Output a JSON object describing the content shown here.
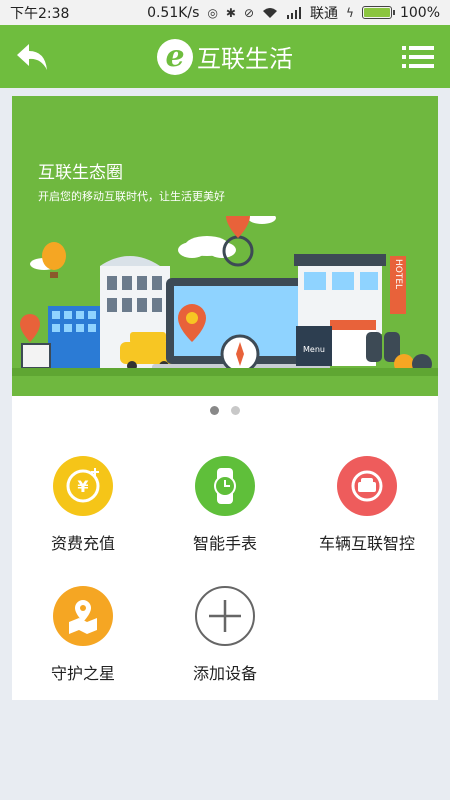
{
  "status_bar": {
    "time": "下午2:38",
    "speed": "0.51K/s",
    "carrier": "联通",
    "battery": "100%",
    "battery_level": 1.0
  },
  "header": {
    "title": "互联生活",
    "logo_letter": "e",
    "back_icon": "back-arrow-icon",
    "menu_icon": "list-menu-icon"
  },
  "banner": {
    "title": "互联生态圈",
    "subtitle": "开启您的移动互联时代，让生活更美好",
    "signs": {
      "hotel": "HOTEL",
      "menu": "Menu"
    },
    "page_count": 2,
    "active_page": 1
  },
  "features": [
    {
      "label": "资费充值",
      "icon": "yen-coin-icon",
      "color": "#f5c518"
    },
    {
      "label": "智能手表",
      "icon": "smartwatch-icon",
      "color": "#5fbf3a"
    },
    {
      "label": "车辆互联智控",
      "icon": "car-icon",
      "color": "#ee5c5c"
    },
    {
      "label": "守护之星",
      "icon": "map-pin-icon",
      "color": "#f5a623"
    },
    {
      "label": "添加设备",
      "icon": "plus-icon",
      "color": "#ffffff"
    }
  ],
  "colors": {
    "brand_green": "#6fbd3e",
    "banner_green": "#6fb83f",
    "background": "#e8ecf2"
  }
}
